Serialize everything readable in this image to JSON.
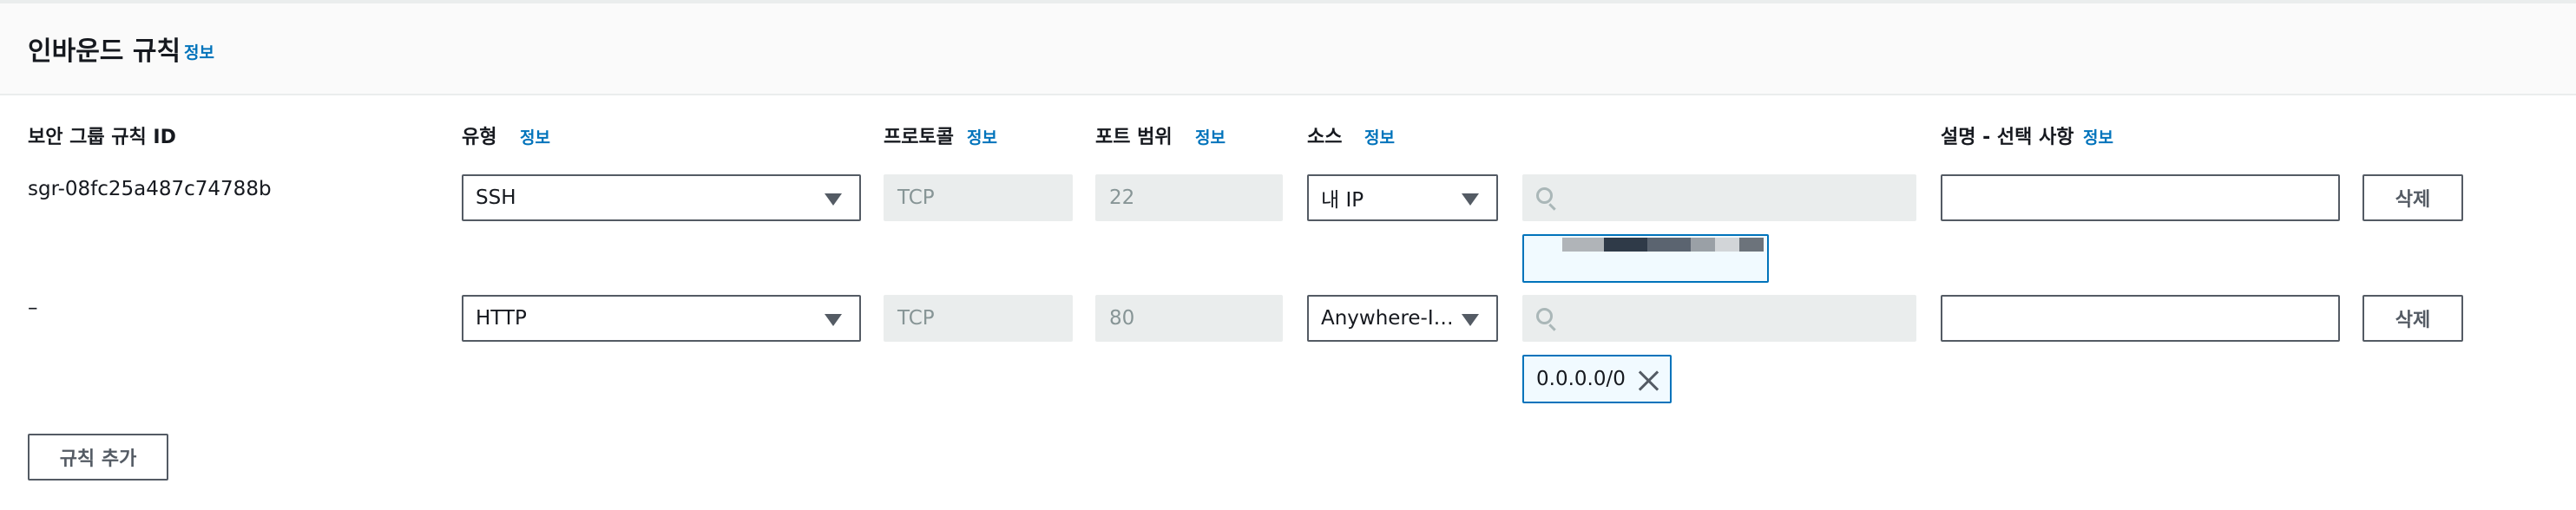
{
  "panel": {
    "title": "인바운드 규칙",
    "info_label": "정보"
  },
  "columns": {
    "rule_id": "보안 그룹 규칙 ID",
    "type": "유형",
    "protocol": "프로토콜",
    "port_range": "포트 범위",
    "source": "소스",
    "description": "설명 - 선택 사항",
    "info_label": "정보"
  },
  "rules": [
    {
      "id": "sgr-08fc25a487c74788b",
      "type": "SSH",
      "protocol": "TCP",
      "port_range": "22",
      "source_type": "내 IP",
      "cidr_search_placeholder": "",
      "description": "",
      "delete_label": "삭제"
    },
    {
      "id": "–",
      "type": "HTTP",
      "protocol": "TCP",
      "port_range": "80",
      "source_type": "Anywhere-I…",
      "cidr_search_placeholder": "",
      "cidr_token": "0.0.0.0/0",
      "description": "",
      "delete_label": "삭제"
    }
  ],
  "add_rule_label": "규칙 추가",
  "colors": {
    "link": "#0073bb",
    "border": "#545b64",
    "disabled_bg": "#eaeded",
    "token_border": "#0073bb"
  },
  "icons": {
    "caret": "caret-down-icon",
    "search": "search-icon",
    "remove": "close-icon"
  }
}
